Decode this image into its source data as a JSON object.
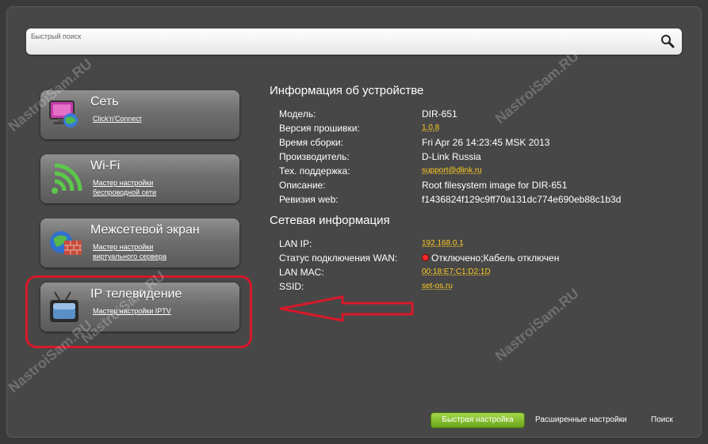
{
  "search": {
    "placeholder": "Быстрый поиск"
  },
  "tiles": [
    {
      "title": "Сеть",
      "links": [
        "Click'n'Connect"
      ]
    },
    {
      "title": "Wi-Fi",
      "links": [
        "Мастер настройки",
        "беспроводной сети"
      ]
    },
    {
      "title": "Межсетевой экран",
      "links": [
        "Мастер настройки",
        "виртуального сервера"
      ]
    },
    {
      "title": "IP телевидение",
      "links": [
        "Мастер настройки IPTV"
      ]
    }
  ],
  "device_info": {
    "title": "Информация об устройстве",
    "rows": [
      {
        "label": "Модель:",
        "value": "DIR-651"
      },
      {
        "label": "Версия прошивки:",
        "value": "1.0.8"
      },
      {
        "label": "Время сборки:",
        "value": "Fri Apr 26 14:23:45 MSK 2013"
      },
      {
        "label": "Производитель:",
        "value": "D-Link Russia"
      },
      {
        "label": "Тех. поддержка:",
        "value": "support@dlink.ru"
      },
      {
        "label": "Описание:",
        "value": "Root filesystem image for DIR-651"
      },
      {
        "label": "Ревизия web:",
        "value": "f1436824f129c9ff70a131dc774e690eb88c1b3d"
      }
    ]
  },
  "network_info": {
    "title": "Сетевая информация",
    "rows": [
      {
        "label": "LAN IP:",
        "value": "192.168.0.1"
      },
      {
        "label": "Статус подключения WAN:",
        "value": "Отключено;Кабель отключен"
      },
      {
        "label": "LAN MAC:",
        "value": "00:18:E7:C1:D2:1D"
      },
      {
        "label": "SSID:",
        "value": "set-os.ru"
      }
    ]
  },
  "bottom": {
    "quick_setup": "Быстрая настройка",
    "advanced": "Расширенные настройки",
    "search": "Поиск"
  },
  "watermark": "NastroiSam.RU",
  "colors": {
    "accent_green": "#8cc63f",
    "link_yellow": "#ffcc22",
    "highlight_red": "#d8182a"
  }
}
